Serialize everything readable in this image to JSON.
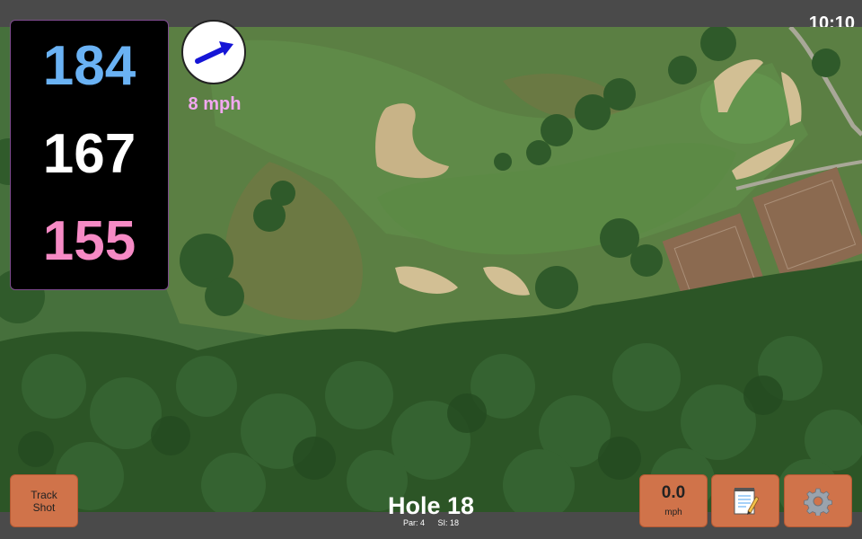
{
  "status": {
    "time": "10:10"
  },
  "distances": {
    "back": "184",
    "middle": "167",
    "front": "155"
  },
  "wind": {
    "speed": "8 mph",
    "direction_icon": "wind-arrow-icon"
  },
  "hole": {
    "title": "Hole 18",
    "par": "Par: 4",
    "stroke_index": "SI: 18"
  },
  "buttons": {
    "track_shot_line1": "Track",
    "track_shot_line2": "Shot",
    "speed_value": "0.0",
    "speed_unit": "mph",
    "notes_icon": "notepad-icon",
    "settings_icon": "gear-icon"
  },
  "colors": {
    "back": "#6ab2f4",
    "middle": "#ffffff",
    "front": "#f68ac5",
    "wind_label": "#f2a8f0",
    "button": "#d0734a"
  }
}
